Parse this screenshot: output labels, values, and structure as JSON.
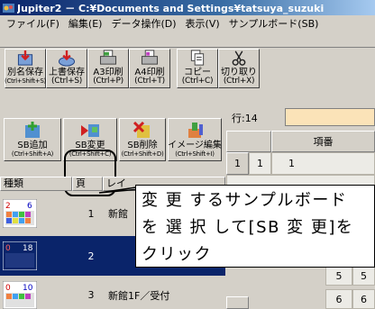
{
  "window": {
    "title": "Jupiter2 － C:¥Documents and Settings¥tatsuya_suzuki"
  },
  "menu": [
    "ファイル(F)",
    "編集(E)",
    "データ操作(D)",
    "表示(V)",
    "サンプルボード(SB)"
  ],
  "toolbar1": [
    {
      "label": "別名保存",
      "shortcut": "(Ctrl+Shift+S)",
      "icon": "save-as-icon"
    },
    {
      "label": "上書保存",
      "shortcut": "(Ctrl+S)",
      "icon": "save-icon"
    },
    {
      "label": "A3印刷",
      "shortcut": "(Ctrl+P)",
      "icon": "print-a3-icon"
    },
    {
      "label": "A4印刷",
      "shortcut": "(Ctrl+T)",
      "icon": "print-a4-icon"
    },
    {
      "label": "コピー",
      "shortcut": "(Ctrl+C)",
      "icon": "copy-icon"
    },
    {
      "label": "切り取り",
      "shortcut": "(Ctrl+X)",
      "icon": "cut-icon"
    }
  ],
  "toolbar2": [
    {
      "label": "SB追加",
      "shortcut": "(Ctrl+Shift+A)",
      "icon": "sb-add-icon"
    },
    {
      "label": "SB変更",
      "shortcut": "(Ctrl+Shift+C)",
      "icon": "sb-change-icon"
    },
    {
      "label": "SB削除",
      "shortcut": "(Ctrl+Shift+D)",
      "icon": "sb-delete-icon"
    },
    {
      "label": "イメージ編集",
      "shortcut": "(Ctrl+Shift+I)",
      "icon": "image-edit-icon"
    }
  ],
  "row_info": {
    "label": "行:14",
    "value": ""
  },
  "grid": {
    "header": "項番",
    "rows": [
      {
        "idx": "1",
        "val": "1"
      },
      {
        "idx": "5",
        "val": "5"
      },
      {
        "idx": "6",
        "val": "6"
      }
    ]
  },
  "list": {
    "columns": [
      "種類",
      "頁",
      "レイ"
    ],
    "rows": [
      {
        "kind_nums": [
          "2",
          "6"
        ],
        "page": "1",
        "name": "新館",
        "selected": false
      },
      {
        "kind_nums": [
          "0",
          "18"
        ],
        "page": "2",
        "name": "",
        "selected": true
      },
      {
        "kind_nums": [
          "0",
          "10"
        ],
        "page": "3",
        "name": "新館1F／受付",
        "selected": false
      }
    ]
  },
  "callout": {
    "line1": "変 更 するサンプルボード",
    "line2": "を 選 択 して[SB 変 更]を",
    "line3": "クリック"
  },
  "colors": {
    "title_bar": "#0a246a",
    "selection": "#0a246a",
    "row_input_bg": "#fbe3b8"
  }
}
